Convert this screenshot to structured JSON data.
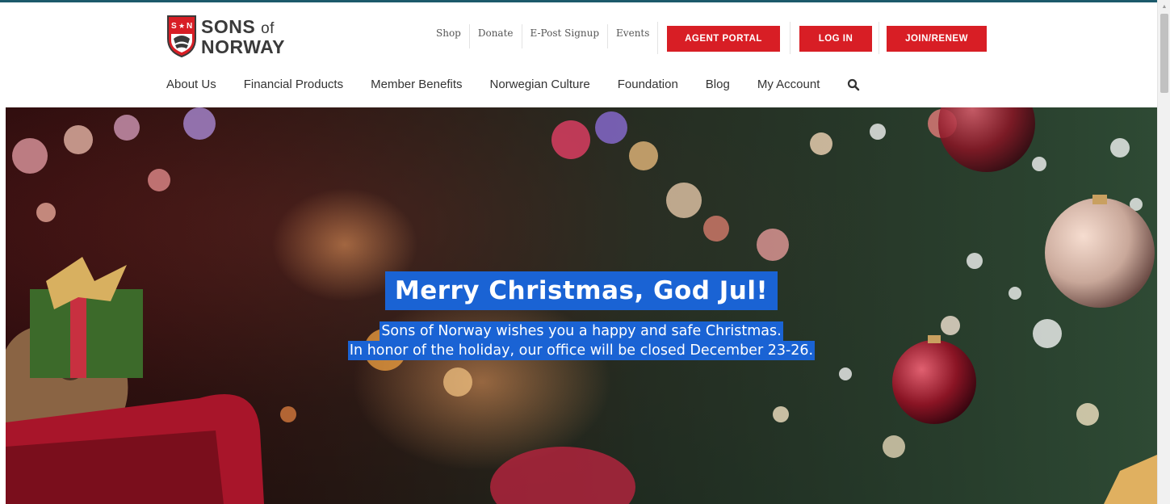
{
  "logo": {
    "line1": "SONS",
    "of": "of",
    "line2": "NORWAY"
  },
  "utility_links": [
    "Shop",
    "Donate",
    "E-Post Signup",
    "Events"
  ],
  "cta": {
    "agent_portal": "AGENT PORTAL",
    "log_in": "LOG IN",
    "join_renew": "JOIN/RENEW"
  },
  "nav": [
    "About Us",
    "Financial Products",
    "Member Benefits",
    "Norwegian Culture",
    "Foundation",
    "Blog",
    "My Account"
  ],
  "hero": {
    "title": "Merry Christmas, God Jul!",
    "line1": "Sons of Norway wishes you a happy and safe Christmas.",
    "line2": "In honor of the holiday, our office will be closed December 23-26."
  },
  "colors": {
    "accent_red": "#d81e25",
    "selection_blue": "#1a63d4",
    "top_rule": "#1c5a6b"
  }
}
